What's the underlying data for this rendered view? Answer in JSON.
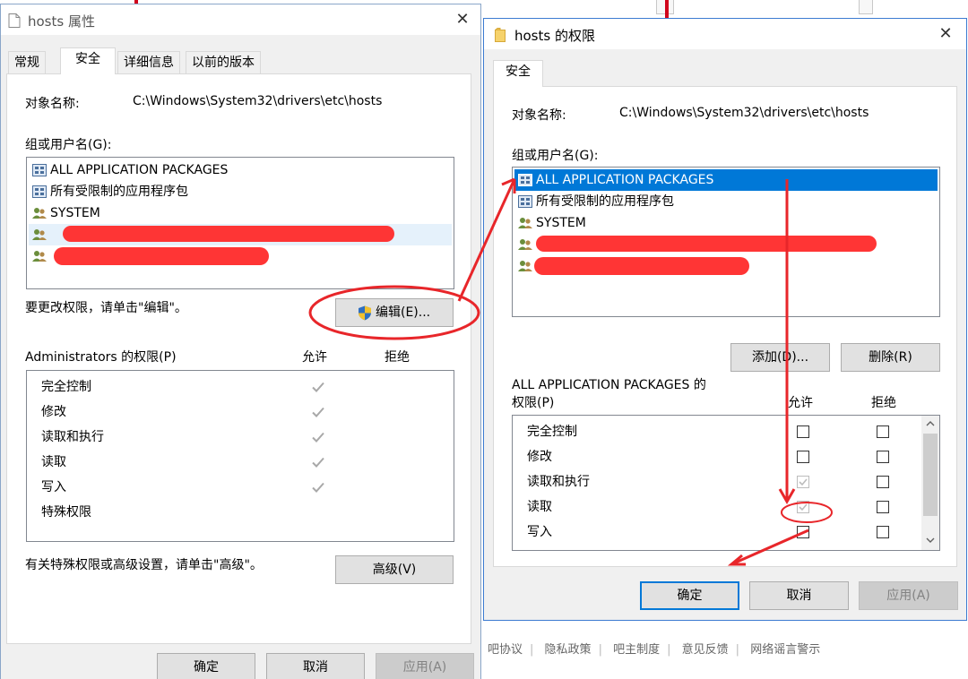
{
  "background_footer": {
    "items": [
      "吧协议",
      "隐私政策",
      "吧主制度",
      "意见反馈",
      "网络谣言警示"
    ],
    "separator": "|"
  },
  "left_dialog": {
    "title": "hosts 属性",
    "close_glyph": "✕",
    "tabs": [
      "常规",
      "安全",
      "详细信息",
      "以前的版本"
    ],
    "active_tab": "安全",
    "object_name_label": "对象名称:",
    "object_name_value": "C:\\Windows\\System32\\drivers\\etc\\hosts",
    "group_label": "组或用户名(G):",
    "users": [
      {
        "label": "ALL APPLICATION PACKAGES",
        "icon": "group-package-icon",
        "redacted": false
      },
      {
        "label": "所有受限制的应用程序包",
        "icon": "group-package-icon",
        "redacted": false
      },
      {
        "label": "SYSTEM",
        "icon": "users-icon",
        "redacted": false
      },
      {
        "label": "",
        "icon": "users-icon",
        "redacted": true
      },
      {
        "label": "",
        "icon": "users-icon",
        "redacted": true
      }
    ],
    "edit_hint": "要更改权限，请单击\"编辑\"。",
    "edit_button": "编辑(E)...",
    "perm_title": "Administrators 的权限(P)",
    "allow_header": "允许",
    "deny_header": "拒绝",
    "permissions": [
      {
        "name": "完全控制",
        "allow": true
      },
      {
        "name": "修改",
        "allow": true
      },
      {
        "name": "读取和执行",
        "allow": true
      },
      {
        "name": "读取",
        "allow": true
      },
      {
        "name": "写入",
        "allow": true
      },
      {
        "name": "特殊权限",
        "allow": false
      }
    ],
    "advanced_hint": "有关特殊权限或高级设置，请单击\"高级\"。",
    "advanced_button": "高级(V)",
    "ok_button": "确定",
    "cancel_button": "取消",
    "apply_button": "应用(A)"
  },
  "right_dialog": {
    "title": "hosts 的权限",
    "close_glyph": "✕",
    "tab": "安全",
    "object_name_label": "对象名称:",
    "object_name_value": "C:\\Windows\\System32\\drivers\\etc\\hosts",
    "group_label": "组或用户名(G):",
    "users": [
      {
        "label": "ALL APPLICATION PACKAGES",
        "icon": "group-package-icon",
        "selected": true,
        "redacted": false
      },
      {
        "label": "所有受限制的应用程序包",
        "icon": "group-package-icon",
        "selected": false,
        "redacted": false
      },
      {
        "label": "SYSTEM",
        "icon": "users-icon",
        "selected": false,
        "redacted": false
      },
      {
        "label": "",
        "icon": "users-icon",
        "selected": false,
        "redacted": true
      },
      {
        "label": "",
        "icon": "users-icon",
        "selected": false,
        "redacted": true
      }
    ],
    "add_button": "添加(D)...",
    "remove_button": "删除(R)",
    "perm_title_line1": "ALL APPLICATION PACKAGES 的",
    "perm_title_line2": "权限(P)",
    "allow_header": "允许",
    "deny_header": "拒绝",
    "permissions": [
      {
        "name": "完全控制",
        "allow": "unchecked",
        "deny": "unchecked"
      },
      {
        "name": "修改",
        "allow": "unchecked",
        "deny": "unchecked"
      },
      {
        "name": "读取和执行",
        "allow": "checked-disabled",
        "deny": "unchecked"
      },
      {
        "name": "读取",
        "allow": "checked-disabled",
        "deny": "unchecked"
      },
      {
        "name": "写入",
        "allow": "unchecked",
        "deny": "unchecked"
      }
    ],
    "ok_button": "确定",
    "cancel_button": "取消",
    "apply_button": "应用(A)"
  },
  "colors": {
    "selection": "#0078d7",
    "annotation_red": "#e8262a",
    "checkmark_grey": "#a8a8a8"
  }
}
